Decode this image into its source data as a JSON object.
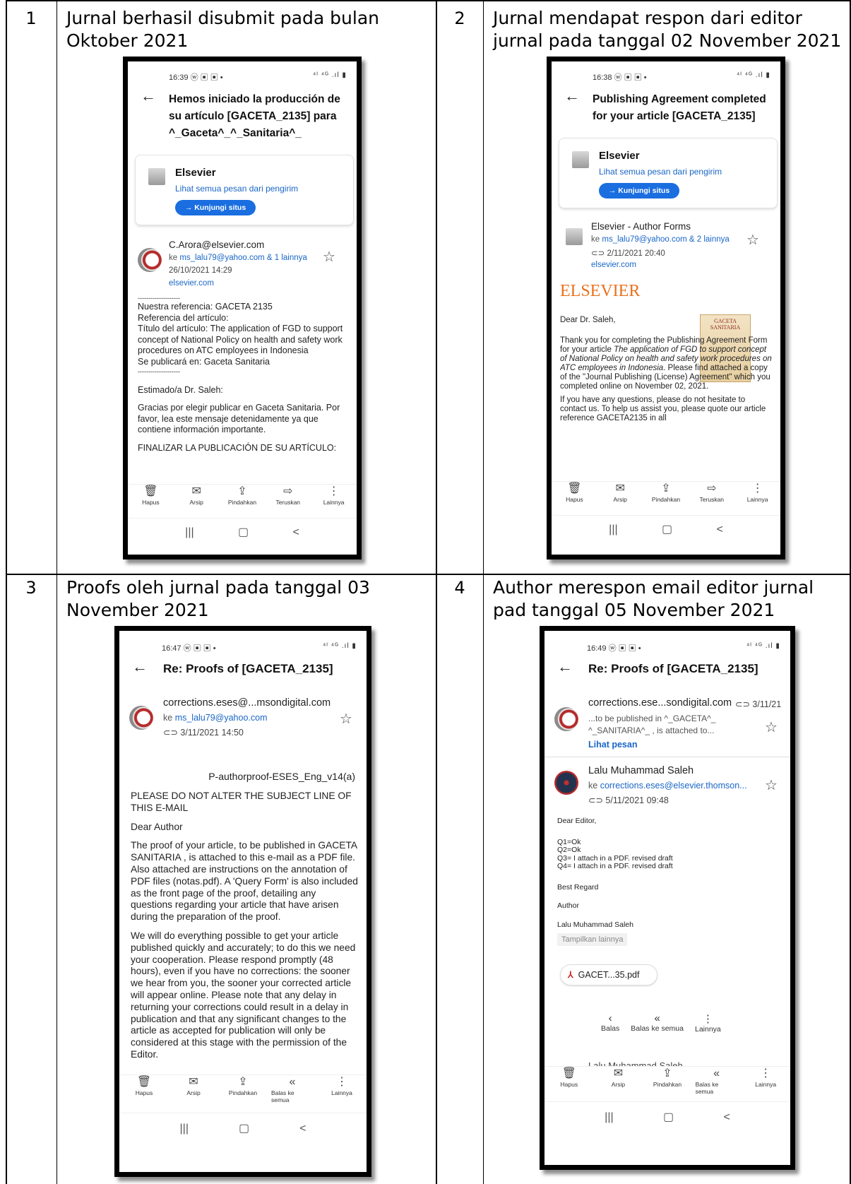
{
  "rows": [
    {
      "num": "1",
      "caption": "Jurnal berhasil disubmit pada bulan Oktober 2021"
    },
    {
      "num": "2",
      "caption": "Jurnal mendapat respon dari editor jurnal pada tanggal 02 November 2021"
    },
    {
      "num": "3",
      "caption": "Proofs oleh jurnal pada tanggal 03 November 2021"
    },
    {
      "num": "4",
      "caption": "Author merespon email editor jurnal pad tanggal 05 November 2021"
    }
  ],
  "toolbar": {
    "hapus": "Hapus",
    "arsip": "Arsip",
    "pindahkan": "Pindahkan",
    "teruskan": "Teruskan",
    "lainnya": "Lainnya",
    "balas_semua": "Balas ke semua",
    "balas": "Balas"
  },
  "icons": {
    "status": "status-icons",
    "nav": [
      "recent-apps-icon",
      "home-icon",
      "back-icon"
    ]
  },
  "s1": {
    "time": "16:39 ⓦ ▣ ▣ •",
    "status_right": "⁴ᴵ ⁴ᴳ .ıl ▮",
    "subject": "Hemos iniciado la producción de su artículo [GACETA_2135] para ^_Gaceta^_^_Sanitaria^_",
    "sender": "Elsevier",
    "see_all": "Lihat semua pesan dari pengirim",
    "visit": "→ Kunjungi situs",
    "from": "C.Arora@elsevier.com",
    "to_prefix": "ke",
    "to_link": "ms_lalu79@yahoo.com & 1 lainnya",
    "date": "26/10/2021 14:29",
    "domain": "elsevier.com",
    "body": [
      "--------------------",
      "Nuestra referencia: GACETA 2135",
      "Referencia del artículo:",
      "Título del artículo:  The application of FGD to support concept of National Policy on health and safety work procedures on ATC employees in Indonesia",
      "Se publicará en: Gaceta Sanitaria",
      "--------------------",
      "Estimado/a Dr. Saleh:",
      "Gracias por elegir publicar en Gaceta Sanitaria. Por favor, lea este mensaje detenidamente ya que contiene información importante.",
      "FINALIZAR LA PUBLICACIÓN DE SU ARTÍCULO:"
    ]
  },
  "s2": {
    "time": "16:38 ⓦ ▣ ▣ •",
    "status_right": "⁴ᴵ ⁴ᴳ .ıl ▮",
    "subject": "Publishing Agreement completed for your article [GACETA_2135]",
    "sender": "Elsevier",
    "see_all": "Lihat semua pesan dari pengirim",
    "visit": "→ Kunjungi situs",
    "from": "Elsevier - Author Forms",
    "to_prefix": "ke",
    "to_link": "ms_lalu79@yahoo.com & 2 lainnya",
    "date": "⊂⊃ 2/11/2021 20:40",
    "domain": "elsevier.com",
    "brand": "ELSEVIER",
    "cover": "GACETA SANITARIA",
    "greeting": "Dear Dr. Saleh,",
    "para1_a": "Thank you for completing the Publishing Agreement Form for your article ",
    "para1_em": "The application of FGD to support concept of National Policy on health and safety work procedures on ATC employees in Indonesia",
    "para1_b": ". Please find attached a copy of the \"Journal Publishing (License) Agreement\" which you completed online on November 02, 2021.",
    "para2": "If you have any questions, please do not hesitate to contact us. To help us assist you, please quote our article reference GACETA2135 in all"
  },
  "s3": {
    "time": "16:47 ⓦ ▣ ▣ •",
    "status_right": "⁴ᴵ ⁴ᴳ .ıl ▮",
    "subject": "Re: Proofs of [GACETA_2135]",
    "from": "corrections.eses@...msondigital.com",
    "to_prefix": "ke",
    "to_link": "ms_lalu79@yahoo.com",
    "date": "⊂⊃ 3/11/2021 14:50",
    "proof_id": "P-authorproof-ESES_Eng_v14(a)",
    "body": [
      "PLEASE DO NOT ALTER THE SUBJECT LINE OF THIS E-MAIL",
      "Dear Author",
      "The proof of your article, to be published in GACETA SANITARIA , is attached to this e-mail as a PDF file. Also attached are instructions on the annotation of PDF files (notas.pdf). A 'Query Form' is also included as the front page of the proof, detailing any questions regarding your article that have arisen during the preparation of the proof.",
      "We will do everything possible to get your article published quickly and accurately; to do this we need your cooperation. Please respond promptly (48 hours), even if you have no corrections: the sooner we hear from you, the sooner your corrected article will appear online. Please note that any delay in returning your corrections could result in a delay in publication and that any significant changes to the article as accepted for publication will only be considered at this stage with the permission of the Editor."
    ]
  },
  "s4": {
    "time": "16:49 ⓦ ▣ ▣ •",
    "status_right": "⁴ᴵ ⁴ᴳ .ıl ▮",
    "subject": "Re: Proofs of [GACETA_2135]",
    "from1": "corrections.ese...sondigital.com",
    "date1": "⊂⊃ 3/11/21",
    "snippet": "...to be published in ^_GACETA^_ ^_SANITARIA^_ , is attached to...",
    "see_msg": "Lihat pesan",
    "from2": "Lalu Muhammad Saleh",
    "to_prefix": "ke",
    "to_link": "corrections.eses@elsevier.thomson...",
    "date2": "⊂⊃ 5/11/2021 09:48",
    "lines": [
      "Dear Editor,",
      "Q1=Ok",
      "Q2=Ok",
      "Q3= I attach in a PDF. revised draft",
      "Q4= I attach in a PDF. revised draft",
      "Best Regard",
      "Author",
      "Lalu Muhammad Saleh"
    ],
    "show_more": "Tampilkan lainnya",
    "attachment": "GACET...35.pdf",
    "next_sender": "Lalu Muhammad Saleh"
  }
}
